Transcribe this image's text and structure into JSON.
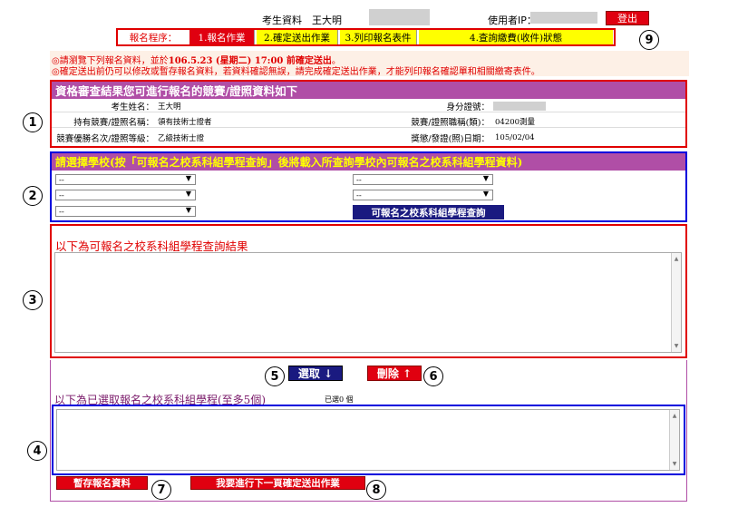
{
  "header": {
    "applicant_label": "考生資料",
    "applicant_name": "王大明",
    "user_ip_label": "使用者IP：",
    "logout": "登出"
  },
  "steps": {
    "label": "報名程序：",
    "items": [
      "1.報名作業",
      "2.確定送出作業",
      "3.列印報名表件",
      "4.查詢繳費(收件)狀態"
    ]
  },
  "notices": {
    "line1_pre": "◎請瀏覽下列報名資料，並於",
    "line1_deadline": "106.5.23 (星期二) 17:00 前確定送出",
    "line1_post": "。",
    "line2": "◎確定送出前仍可以修改或暫存報名資料，若資料確認無誤，請完成確定送出作業，才能列印報名確認單和相關繳寄表件。"
  },
  "section1": {
    "title": "資格審查結果您可進行報名的競賽/證照資料如下",
    "name_label": "考生姓名：",
    "name_value": "王大明",
    "id_label": "身分證號：",
    "cert_name_label": "持有競賽/證照名稱：",
    "cert_name_value": "領有技術士證者",
    "cert_class_label": "競賽/證照職稱(類)：",
    "cert_class_value": "04200測量",
    "rank_label": "競賽優勝名次/證照等級：",
    "rank_value": "乙級技術士證",
    "award_date_label": "獎懲/發證(照)日期：",
    "award_date_value": "105/02/04"
  },
  "section2": {
    "title": "請選擇學校(按「可報名之校系科組學程查詢」後將載入所查詢學校內可報名之校系科組學程資料)",
    "select_placeholder": "--",
    "query_button": "可報名之校系科組學程查詢"
  },
  "section3": {
    "title": "以下為可報名之校系科組學程查詢結果"
  },
  "actions": {
    "select": "選取 ↓",
    "delete": "刪除 ↑"
  },
  "section4": {
    "title": "以下為已選取報名之校系科組學程(至多5個)",
    "count": "已選0 個"
  },
  "footer": {
    "save": "暫存報名資料",
    "next": "我要進行下一頁確定送出作業"
  },
  "markers": [
    "1",
    "2",
    "3",
    "4",
    "5",
    "6",
    "7",
    "8",
    "9"
  ],
  "colors": {
    "accent_red": "#e00010",
    "purple": "#b04ea6",
    "yellow": "#ffff00",
    "navy": "#1a1a80",
    "frame_red": "#e00000",
    "frame_blue": "#0000dd"
  }
}
